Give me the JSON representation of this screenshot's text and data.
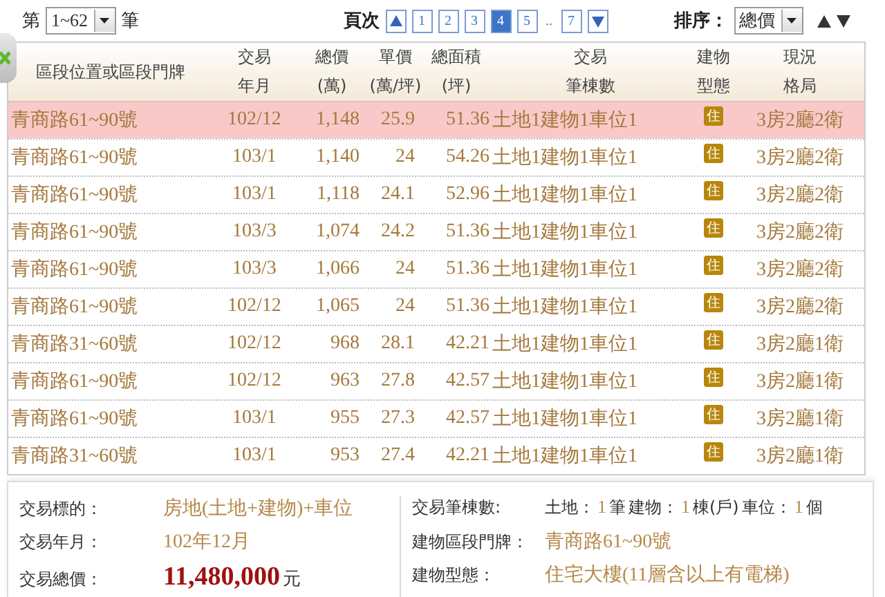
{
  "range": {
    "prefix": "第",
    "value": "1~62",
    "suffix": "筆"
  },
  "pager": {
    "label": "頁次",
    "pages": [
      {
        "label": "1",
        "selected": false
      },
      {
        "label": "2",
        "selected": false
      },
      {
        "label": "3",
        "selected": false
      },
      {
        "label": "4",
        "selected": true
      },
      {
        "label": "5",
        "selected": false
      },
      {
        "label": "..",
        "kind": "gap"
      },
      {
        "label": "7",
        "selected": false
      }
    ]
  },
  "sort": {
    "label": "排序：",
    "value": "總價"
  },
  "table": {
    "columns": [
      [
        "區段位置或區段門牌"
      ],
      [
        "交易",
        "年月"
      ],
      [
        "總價",
        "(萬)"
      ],
      [
        "單價",
        "(萬/坪)"
      ],
      [
        "總面積",
        "(坪)"
      ],
      [
        "交易",
        "筆棟數"
      ],
      [
        "建物",
        "型態"
      ],
      [
        "現況",
        "格局"
      ]
    ],
    "rows": [
      {
        "address": "青商路61~90號",
        "date": "102/12",
        "total": "1,148",
        "unit": "25.9",
        "area": "51.36",
        "parts": "土地1建物1車位1",
        "type": "住",
        "layout": "3房2廳2衛",
        "selected": true
      },
      {
        "address": "青商路61~90號",
        "date": "103/1",
        "total": "1,140",
        "unit": "24",
        "area": "54.26",
        "parts": "土地1建物1車位1",
        "type": "住",
        "layout": "3房2廳2衛",
        "selected": false
      },
      {
        "address": "青商路61~90號",
        "date": "103/1",
        "total": "1,118",
        "unit": "24.1",
        "area": "52.96",
        "parts": "土地1建物1車位1",
        "type": "住",
        "layout": "3房2廳2衛",
        "selected": false
      },
      {
        "address": "青商路61~90號",
        "date": "103/3",
        "total": "1,074",
        "unit": "24.2",
        "area": "51.36",
        "parts": "土地1建物1車位1",
        "type": "住",
        "layout": "3房2廳2衛",
        "selected": false
      },
      {
        "address": "青商路61~90號",
        "date": "103/3",
        "total": "1,066",
        "unit": "24",
        "area": "51.36",
        "parts": "土地1建物1車位1",
        "type": "住",
        "layout": "3房2廳2衛",
        "selected": false
      },
      {
        "address": "青商路61~90號",
        "date": "102/12",
        "total": "1,065",
        "unit": "24",
        "area": "51.36",
        "parts": "土地1建物1車位1",
        "type": "住",
        "layout": "3房2廳2衛",
        "selected": false
      },
      {
        "address": "青商路31~60號",
        "date": "102/12",
        "total": "968",
        "unit": "28.1",
        "area": "42.21",
        "parts": "土地1建物1車位1",
        "type": "住",
        "layout": "3房2廳1衛",
        "selected": false
      },
      {
        "address": "青商路61~90號",
        "date": "102/12",
        "total": "963",
        "unit": "27.8",
        "area": "42.57",
        "parts": "土地1建物1車位1",
        "type": "住",
        "layout": "3房2廳1衛",
        "selected": false
      },
      {
        "address": "青商路61~90號",
        "date": "103/1",
        "total": "955",
        "unit": "27.3",
        "area": "42.57",
        "parts": "土地1建物1車位1",
        "type": "住",
        "layout": "3房2廳1衛",
        "selected": false
      },
      {
        "address": "青商路31~60號",
        "date": "103/1",
        "total": "953",
        "unit": "27.4",
        "area": "42.21",
        "parts": "土地1建物1車位1",
        "type": "住",
        "layout": "3房2廳1衛",
        "selected": false
      }
    ]
  },
  "detail": {
    "left": [
      {
        "label": "交易標的：",
        "value": "房地(土地+建物)+車位",
        "kind": "plain"
      },
      {
        "label": "交易年月：",
        "value": "102年12月",
        "kind": "plain"
      },
      {
        "label": "交易總價：",
        "value": "11,480,000",
        "unit": "元",
        "kind": "price"
      }
    ],
    "right": [
      {
        "label": "交易筆棟數:",
        "kind": "counts",
        "parts": [
          {
            "label": "土地：",
            "value": "1",
            "unit": "筆"
          },
          {
            "label": "建物：",
            "value": "1",
            "unit": "棟(戶)"
          },
          {
            "label": "車位：",
            "value": "1",
            "unit": "個"
          }
        ]
      },
      {
        "label": "建物區段門牌：",
        "value": "青商路61~90號",
        "kind": "plain"
      },
      {
        "label": "建物型態：",
        "value": "住宅大樓(11層含以上有電梯)",
        "kind": "plain"
      }
    ]
  }
}
